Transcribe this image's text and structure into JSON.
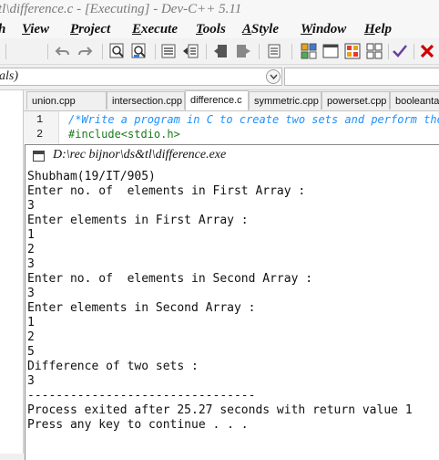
{
  "ide": {
    "title": "tl\\difference.c - [Executing] - Dev-C++ 5.11"
  },
  "menu": [
    {
      "label": "h",
      "u": ""
    },
    {
      "label": "View",
      "u": "V"
    },
    {
      "label": "Project",
      "u": "P"
    },
    {
      "label": "Execute",
      "u": "E"
    },
    {
      "label": "Tools",
      "u": "T"
    },
    {
      "label": "AStyle",
      "u": "A"
    },
    {
      "label": "Window",
      "u": "W"
    },
    {
      "label": "Help",
      "u": "H"
    }
  ],
  "combo": {
    "value": "als)"
  },
  "tabs": [
    "union.cpp",
    "intersection.cpp",
    "difference.c",
    "symmetric.cpp",
    "powerset.cpp",
    "booleantable.cp"
  ],
  "editor": {
    "line_numbers": [
      "1",
      "2"
    ],
    "lines": [
      "/*Write a program in C to create two sets and perform the d",
      "#include<stdio.h>"
    ]
  },
  "console": {
    "title": "D:\\rec bijnor\\ds&tl\\difference.exe",
    "lines": [
      "Shubham(19/IT/905)",
      "Enter no. of  elements in First Array :",
      "3",
      "Enter elements in First Array :",
      "1",
      "2",
      "3",
      "Enter no. of  elements in Second Array :",
      "3",
      "Enter elements in Second Array :",
      "1",
      "2",
      "5",
      "Difference of two sets :",
      "3",
      "--------------------------------",
      "Process exited after 25.27 seconds with return value 1",
      "Press any key to continue . . ."
    ]
  },
  "icons": {
    "toolbar": [
      "undo-icon",
      "redo-icon",
      "find-icon",
      "replace-icon",
      "indent-icon",
      "unindent-icon",
      "bookmark-icon",
      "bookmark-nav-icon",
      "compile-icon",
      "layout-icon",
      "window-icon",
      "colors-icon",
      "grid-icon",
      "check-icon",
      "close-icon"
    ]
  },
  "colors": {
    "comment": "#1e90ff",
    "preprocessor": "#1a7a1a",
    "close_red": "#d00000",
    "check_purple": "#6a3fa0"
  }
}
